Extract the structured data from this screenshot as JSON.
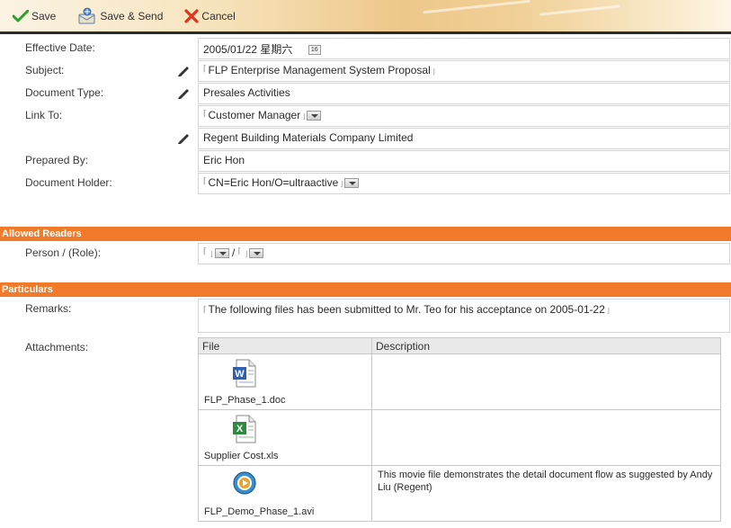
{
  "toolbar": {
    "save_label": "Save",
    "save_send_label": "Save & Send",
    "cancel_label": "Cancel"
  },
  "colors": {
    "section_bar": "#f07a2a",
    "save_check": "#2f9e2f",
    "cancel_x": "#e0341d"
  },
  "fields": {
    "effective_date": {
      "label": "Effective Date:",
      "value": "2005/01/22 星期六",
      "calendar_icon": "16"
    },
    "subject": {
      "label": "Subject:",
      "value": "FLP Enterprise Management System Proposal"
    },
    "document_type": {
      "label": "Document Type:",
      "value": "Presales Activities"
    },
    "link_to": {
      "label": "Link To:",
      "value": "Customer Manager"
    },
    "link_company": {
      "value": "Regent Building Materials Company Limited"
    },
    "prepared_by": {
      "label": "Prepared By:",
      "value": "Eric Hon"
    },
    "document_holder": {
      "label": "Document Holder:",
      "value": "CN=Eric Hon/O=ultraactive"
    }
  },
  "sections": {
    "allowed_readers": "Allowed Readers",
    "particulars": "Particulars"
  },
  "readers": {
    "person_role_label": "Person / (Role):",
    "separator": "/"
  },
  "particulars": {
    "remarks_label": "Remarks:",
    "remarks_value": "The following files has been submitted to Mr. Teo for his acceptance on 2005-01-22",
    "attachments_label": "Attachments:",
    "table": {
      "headers": [
        "File",
        "Description"
      ],
      "rows": [
        {
          "file": "FLP_Phase_1.doc",
          "icon": "word-document-icon",
          "description": ""
        },
        {
          "file": "Supplier Cost.xls",
          "icon": "excel-spreadsheet-icon",
          "description": ""
        },
        {
          "file": "FLP_Demo_Phase_1.avi",
          "icon": "video-file-icon",
          "description": "This movie file demonstrates the detail document flow as suggested by Andy Liu (Regent)"
        }
      ]
    }
  }
}
